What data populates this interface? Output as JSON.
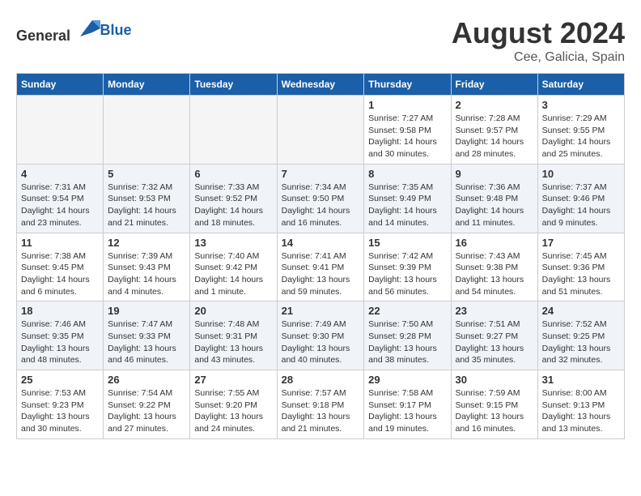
{
  "header": {
    "logo_general": "General",
    "logo_blue": "Blue",
    "month_year": "August 2024",
    "location": "Cee, Galicia, Spain"
  },
  "days_of_week": [
    "Sunday",
    "Monday",
    "Tuesday",
    "Wednesday",
    "Thursday",
    "Friday",
    "Saturday"
  ],
  "weeks": [
    [
      {
        "day": "",
        "sunrise": "",
        "sunset": "",
        "daylight": ""
      },
      {
        "day": "",
        "sunrise": "",
        "sunset": "",
        "daylight": ""
      },
      {
        "day": "",
        "sunrise": "",
        "sunset": "",
        "daylight": ""
      },
      {
        "day": "",
        "sunrise": "",
        "sunset": "",
        "daylight": ""
      },
      {
        "day": "1",
        "sunrise": "Sunrise: 7:27 AM",
        "sunset": "Sunset: 9:58 PM",
        "daylight": "Daylight: 14 hours and 30 minutes."
      },
      {
        "day": "2",
        "sunrise": "Sunrise: 7:28 AM",
        "sunset": "Sunset: 9:57 PM",
        "daylight": "Daylight: 14 hours and 28 minutes."
      },
      {
        "day": "3",
        "sunrise": "Sunrise: 7:29 AM",
        "sunset": "Sunset: 9:55 PM",
        "daylight": "Daylight: 14 hours and 25 minutes."
      }
    ],
    [
      {
        "day": "4",
        "sunrise": "Sunrise: 7:31 AM",
        "sunset": "Sunset: 9:54 PM",
        "daylight": "Daylight: 14 hours and 23 minutes."
      },
      {
        "day": "5",
        "sunrise": "Sunrise: 7:32 AM",
        "sunset": "Sunset: 9:53 PM",
        "daylight": "Daylight: 14 hours and 21 minutes."
      },
      {
        "day": "6",
        "sunrise": "Sunrise: 7:33 AM",
        "sunset": "Sunset: 9:52 PM",
        "daylight": "Daylight: 14 hours and 18 minutes."
      },
      {
        "day": "7",
        "sunrise": "Sunrise: 7:34 AM",
        "sunset": "Sunset: 9:50 PM",
        "daylight": "Daylight: 14 hours and 16 minutes."
      },
      {
        "day": "8",
        "sunrise": "Sunrise: 7:35 AM",
        "sunset": "Sunset: 9:49 PM",
        "daylight": "Daylight: 14 hours and 14 minutes."
      },
      {
        "day": "9",
        "sunrise": "Sunrise: 7:36 AM",
        "sunset": "Sunset: 9:48 PM",
        "daylight": "Daylight: 14 hours and 11 minutes."
      },
      {
        "day": "10",
        "sunrise": "Sunrise: 7:37 AM",
        "sunset": "Sunset: 9:46 PM",
        "daylight": "Daylight: 14 hours and 9 minutes."
      }
    ],
    [
      {
        "day": "11",
        "sunrise": "Sunrise: 7:38 AM",
        "sunset": "Sunset: 9:45 PM",
        "daylight": "Daylight: 14 hours and 6 minutes."
      },
      {
        "day": "12",
        "sunrise": "Sunrise: 7:39 AM",
        "sunset": "Sunset: 9:43 PM",
        "daylight": "Daylight: 14 hours and 4 minutes."
      },
      {
        "day": "13",
        "sunrise": "Sunrise: 7:40 AM",
        "sunset": "Sunset: 9:42 PM",
        "daylight": "Daylight: 14 hours and 1 minute."
      },
      {
        "day": "14",
        "sunrise": "Sunrise: 7:41 AM",
        "sunset": "Sunset: 9:41 PM",
        "daylight": "Daylight: 13 hours and 59 minutes."
      },
      {
        "day": "15",
        "sunrise": "Sunrise: 7:42 AM",
        "sunset": "Sunset: 9:39 PM",
        "daylight": "Daylight: 13 hours and 56 minutes."
      },
      {
        "day": "16",
        "sunrise": "Sunrise: 7:43 AM",
        "sunset": "Sunset: 9:38 PM",
        "daylight": "Daylight: 13 hours and 54 minutes."
      },
      {
        "day": "17",
        "sunrise": "Sunrise: 7:45 AM",
        "sunset": "Sunset: 9:36 PM",
        "daylight": "Daylight: 13 hours and 51 minutes."
      }
    ],
    [
      {
        "day": "18",
        "sunrise": "Sunrise: 7:46 AM",
        "sunset": "Sunset: 9:35 PM",
        "daylight": "Daylight: 13 hours and 48 minutes."
      },
      {
        "day": "19",
        "sunrise": "Sunrise: 7:47 AM",
        "sunset": "Sunset: 9:33 PM",
        "daylight": "Daylight: 13 hours and 46 minutes."
      },
      {
        "day": "20",
        "sunrise": "Sunrise: 7:48 AM",
        "sunset": "Sunset: 9:31 PM",
        "daylight": "Daylight: 13 hours and 43 minutes."
      },
      {
        "day": "21",
        "sunrise": "Sunrise: 7:49 AM",
        "sunset": "Sunset: 9:30 PM",
        "daylight": "Daylight: 13 hours and 40 minutes."
      },
      {
        "day": "22",
        "sunrise": "Sunrise: 7:50 AM",
        "sunset": "Sunset: 9:28 PM",
        "daylight": "Daylight: 13 hours and 38 minutes."
      },
      {
        "day": "23",
        "sunrise": "Sunrise: 7:51 AM",
        "sunset": "Sunset: 9:27 PM",
        "daylight": "Daylight: 13 hours and 35 minutes."
      },
      {
        "day": "24",
        "sunrise": "Sunrise: 7:52 AM",
        "sunset": "Sunset: 9:25 PM",
        "daylight": "Daylight: 13 hours and 32 minutes."
      }
    ],
    [
      {
        "day": "25",
        "sunrise": "Sunrise: 7:53 AM",
        "sunset": "Sunset: 9:23 PM",
        "daylight": "Daylight: 13 hours and 30 minutes."
      },
      {
        "day": "26",
        "sunrise": "Sunrise: 7:54 AM",
        "sunset": "Sunset: 9:22 PM",
        "daylight": "Daylight: 13 hours and 27 minutes."
      },
      {
        "day": "27",
        "sunrise": "Sunrise: 7:55 AM",
        "sunset": "Sunset: 9:20 PM",
        "daylight": "Daylight: 13 hours and 24 minutes."
      },
      {
        "day": "28",
        "sunrise": "Sunrise: 7:57 AM",
        "sunset": "Sunset: 9:18 PM",
        "daylight": "Daylight: 13 hours and 21 minutes."
      },
      {
        "day": "29",
        "sunrise": "Sunrise: 7:58 AM",
        "sunset": "Sunset: 9:17 PM",
        "daylight": "Daylight: 13 hours and 19 minutes."
      },
      {
        "day": "30",
        "sunrise": "Sunrise: 7:59 AM",
        "sunset": "Sunset: 9:15 PM",
        "daylight": "Daylight: 13 hours and 16 minutes."
      },
      {
        "day": "31",
        "sunrise": "Sunrise: 8:00 AM",
        "sunset": "Sunset: 9:13 PM",
        "daylight": "Daylight: 13 hours and 13 minutes."
      }
    ]
  ]
}
